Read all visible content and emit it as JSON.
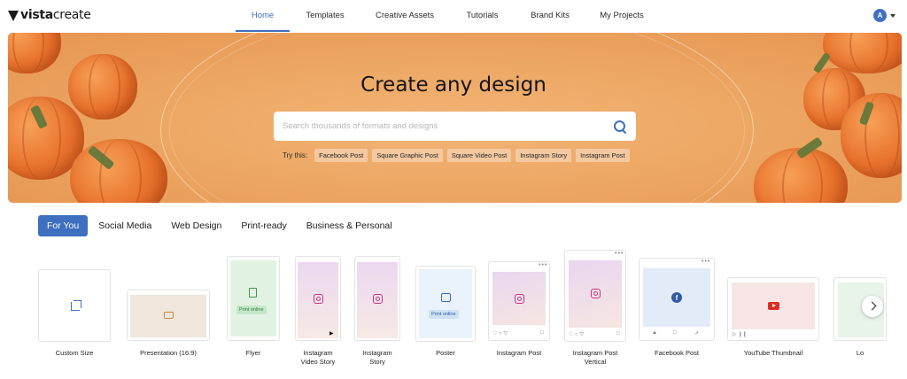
{
  "brand": {
    "logo_text_bold": "vista",
    "logo_text_regular": "create"
  },
  "nav": {
    "items": [
      {
        "label": "Home",
        "active": true
      },
      {
        "label": "Templates"
      },
      {
        "label": "Creative Assets"
      },
      {
        "label": "Tutorials"
      },
      {
        "label": "Brand Kits"
      },
      {
        "label": "My Projects"
      }
    ],
    "avatar_letter": "A"
  },
  "hero": {
    "title": "Create any design",
    "search_placeholder": "Search thousands of formats and designs",
    "try_label": "Try this:",
    "suggestions": [
      "Facebook Post",
      "Square Graphic Post",
      "Square Video Post",
      "Instagram Story",
      "Instagram Post"
    ]
  },
  "tabs": [
    {
      "label": "For You",
      "active": true
    },
    {
      "label": "Social Media"
    },
    {
      "label": "Web Design"
    },
    {
      "label": "Print-ready"
    },
    {
      "label": "Business & Personal"
    }
  ],
  "formats": [
    {
      "label": "Custom Size"
    },
    {
      "label": "Presentation (16:9)"
    },
    {
      "label": "Flyer",
      "badge": "Print online"
    },
    {
      "label_line1": "Instagram",
      "label_line2": "Video Story"
    },
    {
      "label_line1": "Instagram",
      "label_line2": "Story"
    },
    {
      "label": "Poster",
      "badge": "Print online"
    },
    {
      "label": "Instagram Post"
    },
    {
      "label_line1": "Instagram Post",
      "label_line2": "Vertical"
    },
    {
      "label": "Facebook Post"
    },
    {
      "label": "YouTube Thumbnail"
    },
    {
      "label": "Lo"
    }
  ],
  "colors": {
    "accent": "#3f6fbf",
    "hero_orange": "#eda865",
    "chip_bg": "#f4c9a0"
  },
  "icons": {
    "search": "search-icon",
    "next": "chevron-right-icon",
    "instagram": "instagram-icon",
    "facebook": "facebook-icon",
    "youtube": "youtube-icon"
  }
}
